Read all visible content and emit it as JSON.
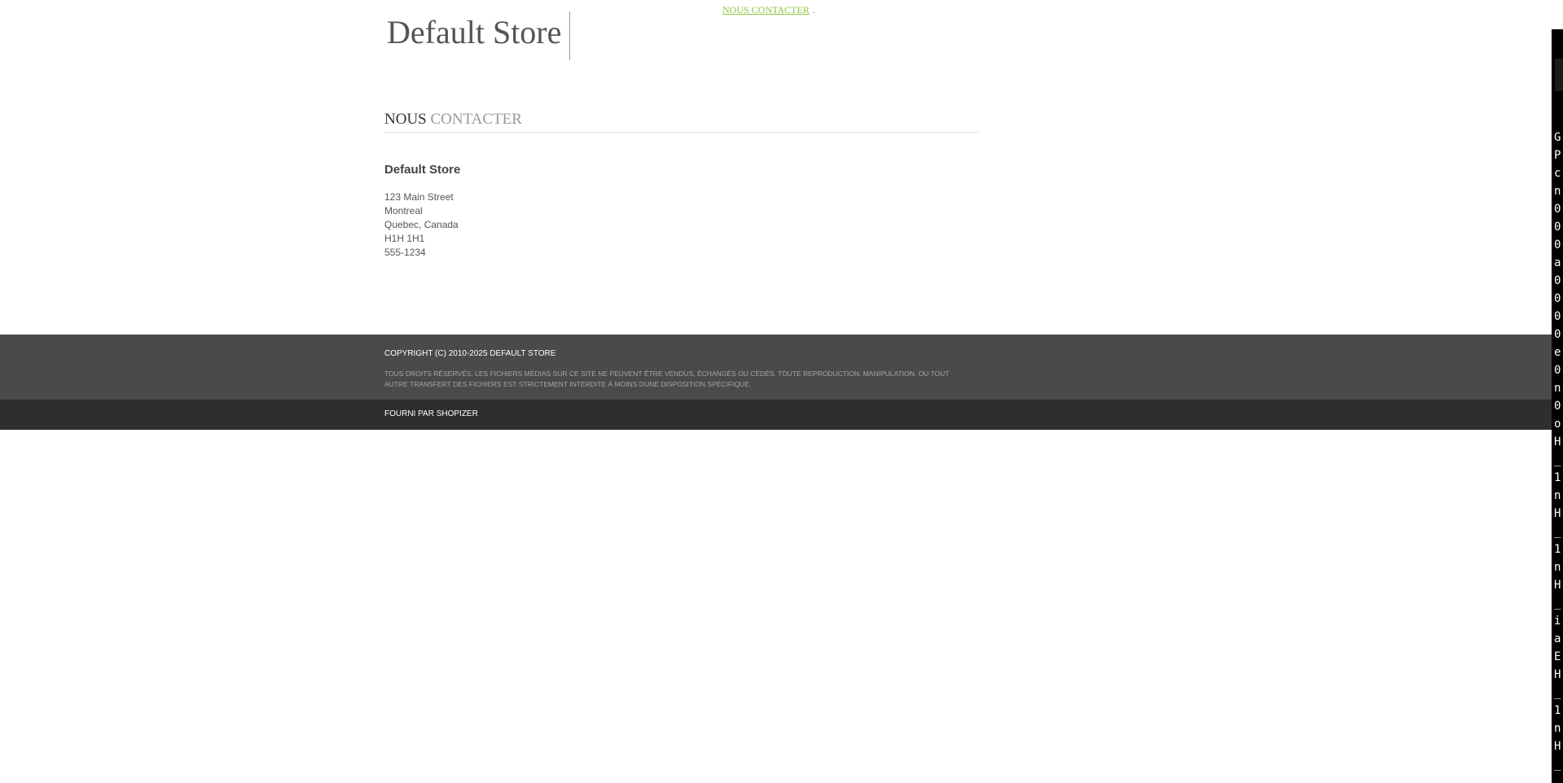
{
  "header": {
    "logo_text": "Default Store",
    "contact_link": "NOUS CONTACTER",
    "separator": "."
  },
  "main": {
    "title_word1": "NOUS",
    "title_word2": "CONTACTER",
    "store_name": "Default Store",
    "address": {
      "street": "123 Main Street",
      "city": "Montreal",
      "region": "Quebec, Canada",
      "postal": "H1H 1H1",
      "phone": "555-1234"
    }
  },
  "footer": {
    "copyright": "COPYRIGHT (C) 2010-2025  DEFAULT STORE",
    "rights_text": "TOUS DROITS RÉSERVÉS. LES FICHIERS MÉDIAS SUR CE SITE NE PEUVENT ÊTRE VENDUS, ÉCHANGÉS OU CÉDÉS. TOUTE REPRODUCTION, MANIPULATION, OU TOUT AUTRE TRANSFERT DES FICHIERS EST STRICTEMENT INTERDITE À MOINS DUNE DISPOSITION SPÉCIFIQUE.",
    "powered_by": "FOURNI PAR SHOPIZER"
  },
  "side_panel": {
    "text": "G\nP\nc\nn\n0\n0\n0\na\n0\n0\n0\n0\ne\n0\nn\n0\no\nH\n_\n1\nn\nH\n_\n1\nn\nH\n_\ni\na\nE\nH\n_\n1\nn\nH\n_"
  },
  "colors": {
    "link": "#8ec641",
    "footer_top": "#4a4a4a",
    "footer_bottom": "#2e2e2e"
  }
}
